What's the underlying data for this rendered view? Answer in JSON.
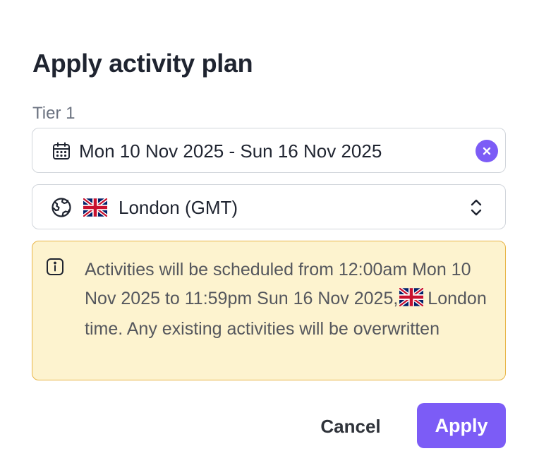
{
  "dialog": {
    "title": "Apply activity plan",
    "field_label": "Tier 1",
    "date_range": {
      "value": "Mon 10 Nov 2025 - Sun 16 Nov 2025",
      "icon": "calendar-icon",
      "clear_icon": "clear-icon"
    },
    "timezone": {
      "value": "London (GMT)",
      "flag": "uk-flag-icon",
      "icon": "globe-icon",
      "selector_icon": "chevron-up-down-icon"
    },
    "notice": {
      "icon": "info-icon",
      "text_before_flag": "Activities will be scheduled from 12:00am Mon 10 Nov 2025 to 11:59pm Sun 16 Nov 2025,",
      "text_after_flag": "London time. Any existing activities will be overwritten"
    },
    "actions": {
      "cancel_label": "Cancel",
      "apply_label": "Apply"
    }
  },
  "colors": {
    "accent": "#7c5cf6",
    "notice_bg": "#fdf3cf",
    "notice_border": "#e8b547",
    "text_primary": "#1f2430",
    "text_muted": "#6b7280"
  }
}
